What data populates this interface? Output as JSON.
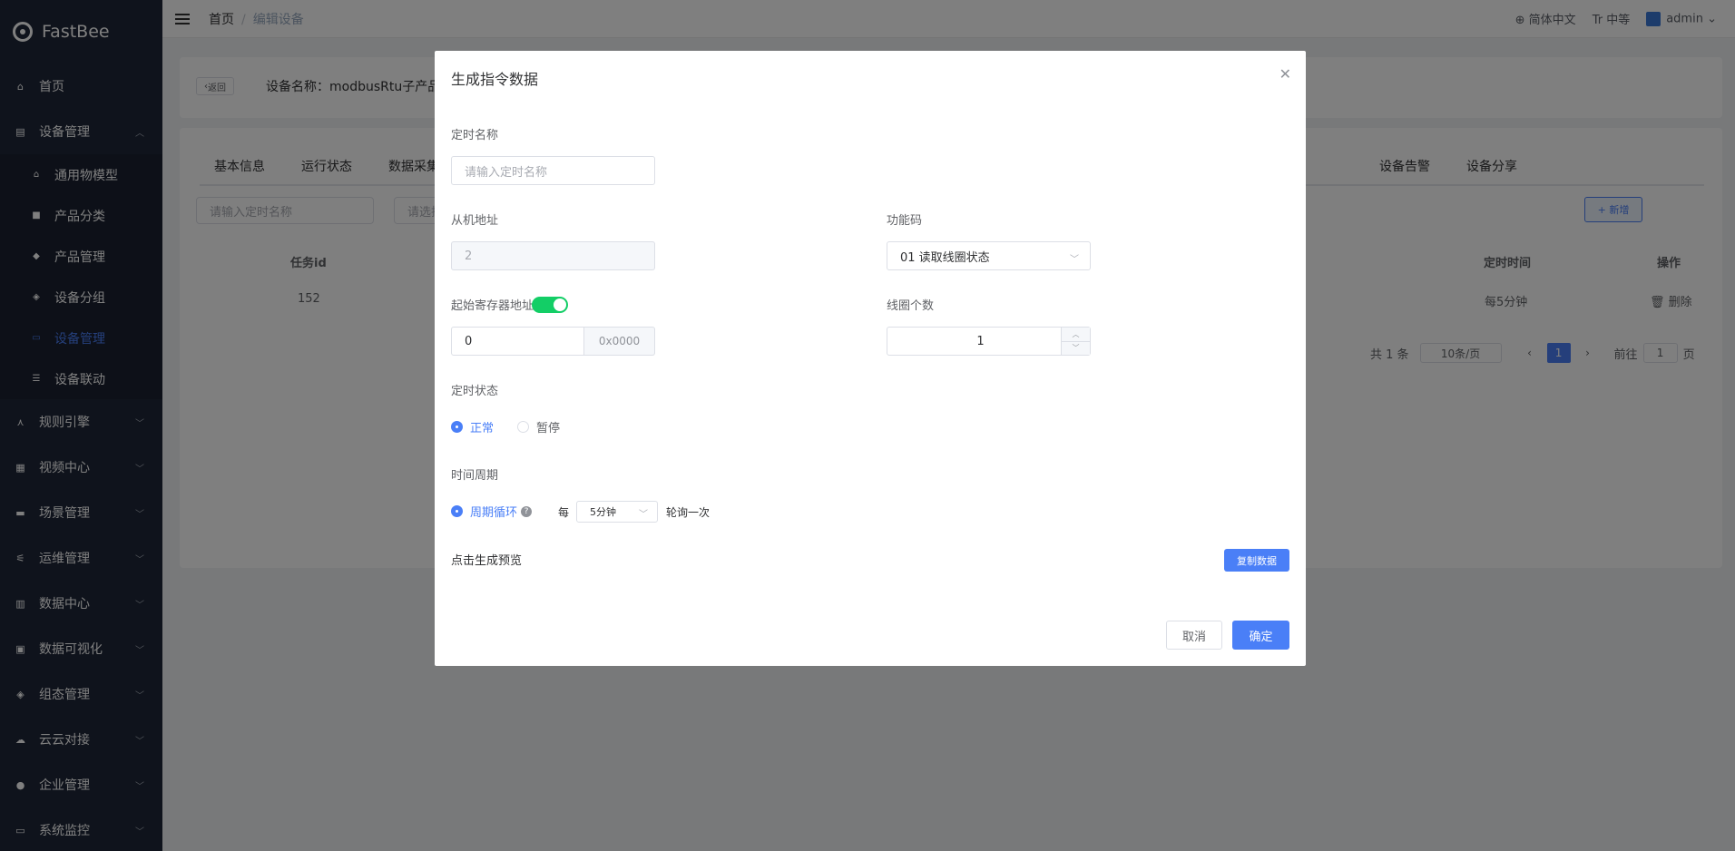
{
  "app": {
    "name": "FastBee"
  },
  "sidebar": {
    "items": [
      {
        "label": "首页",
        "icon": "home-icon"
      },
      {
        "label": "设备管理",
        "icon": "device-icon",
        "expanded": true
      },
      {
        "label": "通用物模型",
        "icon": "model-icon"
      },
      {
        "label": "产品分类",
        "icon": "category-icon"
      },
      {
        "label": "产品管理",
        "icon": "box-icon"
      },
      {
        "label": "设备分组",
        "icon": "layers-icon"
      },
      {
        "label": "设备管理",
        "icon": "monitor-icon",
        "active": true
      },
      {
        "label": "设备联动",
        "icon": "list-icon"
      },
      {
        "label": "规则引擎",
        "icon": "rule-icon"
      },
      {
        "label": "视频中心",
        "icon": "video-icon"
      },
      {
        "label": "场景管理",
        "icon": "scene-icon"
      },
      {
        "label": "运维管理",
        "icon": "ops-icon"
      },
      {
        "label": "数据中心",
        "icon": "chart-icon"
      },
      {
        "label": "数据可视化",
        "icon": "visual-icon"
      },
      {
        "label": "组态管理",
        "icon": "config-icon"
      },
      {
        "label": "云云对接",
        "icon": "cloud-icon"
      },
      {
        "label": "企业管理",
        "icon": "enterprise-icon"
      },
      {
        "label": "系统监控",
        "icon": "monitor-sys-icon"
      }
    ]
  },
  "topbar": {
    "breadcrumb_home": "首页",
    "breadcrumb_sep": "/",
    "breadcrumb_current": "编辑设备",
    "language": "简体中文",
    "size": "中等",
    "user": "admin"
  },
  "page": {
    "back_label": "返回",
    "device_name": "设备名称：modbusRtu子产品-轮询",
    "tabs": [
      "基本信息",
      "运行状态",
      "数据采集",
      "设备告警",
      "设备分享"
    ],
    "filter_placeholder_1": "请输入定时名称",
    "filter_placeholder_2": "请选择",
    "add_label": "+ 新增",
    "table_headers": {
      "id": "任务id",
      "time": "定时时间",
      "action": "操作"
    },
    "row": {
      "id": "152",
      "time": "每5分钟",
      "action": "删除"
    },
    "pagination": {
      "total": "共 1 条",
      "page_size": "10条/页",
      "current": "1",
      "goto_label": "前往",
      "goto_value": "1",
      "page_unit": "页"
    }
  },
  "dialog": {
    "title": "生成指令数据",
    "name_label": "定时名称",
    "name_placeholder": "请输入定时名称",
    "slave_label": "从机地址",
    "slave_value": "2",
    "func_label": "功能码",
    "func_value": "01 读取线圈状态",
    "start_addr_label": "起始寄存器地址",
    "start_addr_value": "0",
    "start_addr_hex": "0x0000",
    "start_addr_toggle": true,
    "coil_count_label": "线圈个数",
    "coil_count_value": "1",
    "status_label": "定时状态",
    "status_normal": "正常",
    "status_pause": "暂停",
    "period_label": "时间周期",
    "period_cycle": "周期循环",
    "period_every": "每",
    "period_value": "5分钟",
    "period_suffix": "轮询一次",
    "preview_label": "点击生成预览",
    "copy_label": "复制数据",
    "cancel_label": "取消",
    "confirm_label": "确定"
  },
  "colors": {
    "primary": "#4a7ff7",
    "sidebar": "#1f2738",
    "switch_on": "#13ce66"
  }
}
